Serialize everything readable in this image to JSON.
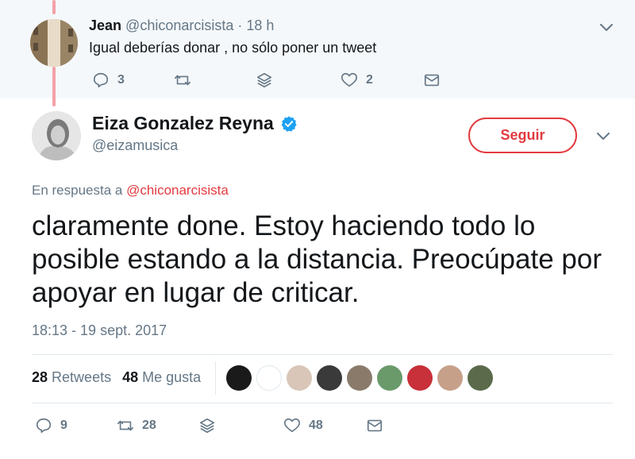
{
  "parent_tweet": {
    "name": "Jean",
    "handle": "@chiconarcisista",
    "separator": "·",
    "time": "18 h",
    "text": "Igual deberías donar , no sólo poner un tweet",
    "actions": {
      "reply_count": "3",
      "retweet_count": "",
      "like_count": "2"
    }
  },
  "main_tweet": {
    "name": "Eiza Gonzalez Reyna",
    "handle": "@eizamusica",
    "follow_label": "Seguir",
    "reply_prefix": "En respuesta a ",
    "reply_mention": "@chiconarcisista",
    "text": "claramente done. Estoy haciendo todo lo posible estando a la distancia. Preocúpate por apoyar en lugar de criticar.",
    "timestamp": "18:13 - 19 sept. 2017",
    "retweets_count": "28",
    "retweets_label": "Retweets",
    "likes_count": "48",
    "likes_label": "Me gusta",
    "actions": {
      "reply_count": "9",
      "retweet_count": "28",
      "like_count": "48"
    }
  },
  "icons": [
    "reply-icon",
    "retweet-icon",
    "stack-icon",
    "heart-icon",
    "envelope-icon",
    "chevron-down-icon",
    "verified-badge-icon"
  ],
  "colors": {
    "accent": "#e23a3f",
    "muted": "#657786",
    "verified": "#1da1f2",
    "thread_line": "#f3a0a8",
    "parent_bg": "#f5f8fa"
  },
  "likers": [
    {
      "color": "#1a1a1a"
    },
    {
      "color": "#ffffff"
    },
    {
      "color": "#d9c6b8"
    },
    {
      "color": "#3a3a3a"
    },
    {
      "color": "#8a7a6a"
    },
    {
      "color": "#6a9a6a"
    },
    {
      "color": "#c8303a"
    },
    {
      "color": "#c7a08a"
    },
    {
      "color": "#5a6a4a"
    }
  ]
}
